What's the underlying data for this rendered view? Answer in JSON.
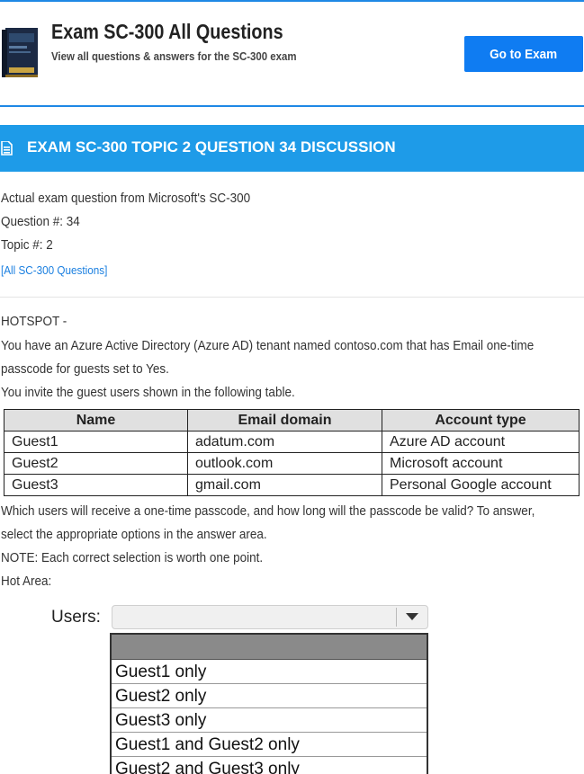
{
  "header": {
    "title": "Exam SC-300 All Questions",
    "subtitle": "View all questions & answers for the SC-300 exam",
    "go_button": "Go to Exam"
  },
  "discussion": {
    "title": "EXAM SC-300 TOPIC 2 QUESTION 34 DISCUSSION"
  },
  "meta": {
    "source": "Actual exam question from Microsoft's SC-300",
    "question_number": "Question #: 34",
    "topic": "Topic #: 2",
    "all_link": "[All SC-300 Questions]"
  },
  "question": {
    "label": "HOTSPOT -",
    "line1": "You have an Azure Active Directory (Azure AD) tenant named contoso.com that has Email one-time",
    "line2": "passcode for guests set to Yes.",
    "line3": "You invite the guest users shown in the following table.",
    "after1": "Which users will receive a one-time passcode, and how long will the passcode be valid? To answer,",
    "after2": "select the appropriate options in the answer area.",
    "note": "NOTE: Each correct selection is worth one point.",
    "hot_area": "Hot Area:"
  },
  "table": {
    "headers": [
      "Name",
      "Email domain",
      "Account type"
    ],
    "rows": [
      [
        "Guest1",
        "adatum.com",
        "Azure AD account"
      ],
      [
        "Guest2",
        "outlook.com",
        "Microsoft account"
      ],
      [
        "Guest3",
        "gmail.com",
        "Personal Google account"
      ]
    ]
  },
  "answer_area": {
    "users_label": "Users:",
    "options": [
      "Guest1 only",
      "Guest2 only",
      "Guest3 only",
      "Guest1 and Guest2 only",
      "Guest2 and Guest3 only"
    ]
  },
  "colors": {
    "accent": "#1e88e5",
    "discussion_bar": "#1e9be8",
    "button": "#0f7cf2",
    "link": "#1a7fe0"
  },
  "icons": {
    "book": "book-cover-icon",
    "discussion": "document-icon",
    "dropdown": "caret-down-icon"
  }
}
